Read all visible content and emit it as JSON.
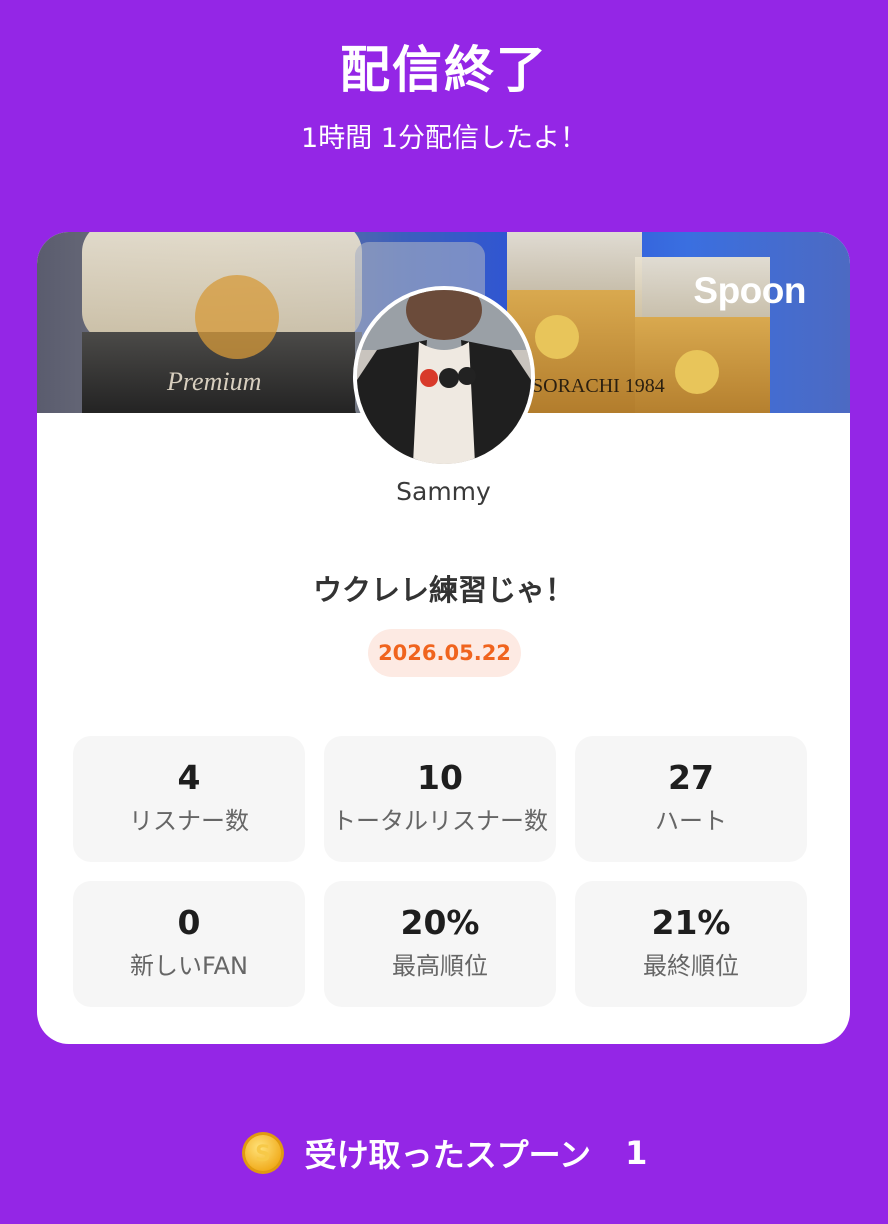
{
  "header": {
    "title": "配信終了",
    "subtitle": "1時間 1分配信したよ！"
  },
  "card": {
    "brand": "Spoon",
    "username": "Sammy",
    "spoon_title": "ウクレレ練習じゃ！",
    "date": "2026.05.22",
    "banner_text_left": "Premium",
    "banner_text_right": "SORACHI 1984",
    "stats": [
      {
        "value": "4",
        "label": "リスナー数"
      },
      {
        "value": "10",
        "label": "トータルリスナー数"
      },
      {
        "value": "27",
        "label": "ハート"
      },
      {
        "value": "0",
        "label": "新しいFAN"
      },
      {
        "value": "20%",
        "label": "最高順位"
      },
      {
        "value": "21%",
        "label": "最終順位"
      }
    ]
  },
  "footer": {
    "received_label": "受け取ったスプーン",
    "received_count": "1",
    "coin_icon": "spoon-coin-icon"
  },
  "colors": {
    "background": "#9426e6",
    "date_text": "#f0641e",
    "date_pill": "#fdeae3",
    "stat_tile": "#f6f6f6"
  }
}
